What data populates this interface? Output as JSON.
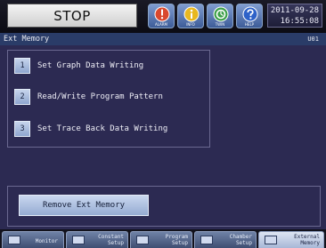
{
  "status": "STOP",
  "toolbar": {
    "alarm_label": "ALARM",
    "info_label": "INFO",
    "twin_label": "TWIN",
    "help_label": "HELP"
  },
  "datetime": {
    "date": "2011-09-28",
    "time": "16:55:08"
  },
  "titlebar": {
    "title": "Ext Memory",
    "code": "U01"
  },
  "menu": [
    {
      "number": "1",
      "label": "Set Graph Data Writing"
    },
    {
      "number": "2",
      "label": "Read/Write Program Pattern"
    },
    {
      "number": "3",
      "label": "Set Trace Back Data Writing"
    }
  ],
  "remove_button": "Remove Ext Memory",
  "tabs": {
    "monitor": "Monitor",
    "constant_1": "Constant",
    "constant_2": "Setup",
    "program_1": "Program",
    "program_2": "Setup",
    "chamber_1": "Chamber",
    "chamber_2": "Setup",
    "external_1": "External",
    "external_2": "Memory"
  },
  "colors": {
    "panel": "#2c2a52",
    "titlebar": "#2a3c68",
    "button": "#95abd2",
    "alarm_icon": "#d9482e",
    "info_icon": "#e8b820",
    "twin_icon": "#3da04a",
    "help_icon": "#2e62c8"
  }
}
